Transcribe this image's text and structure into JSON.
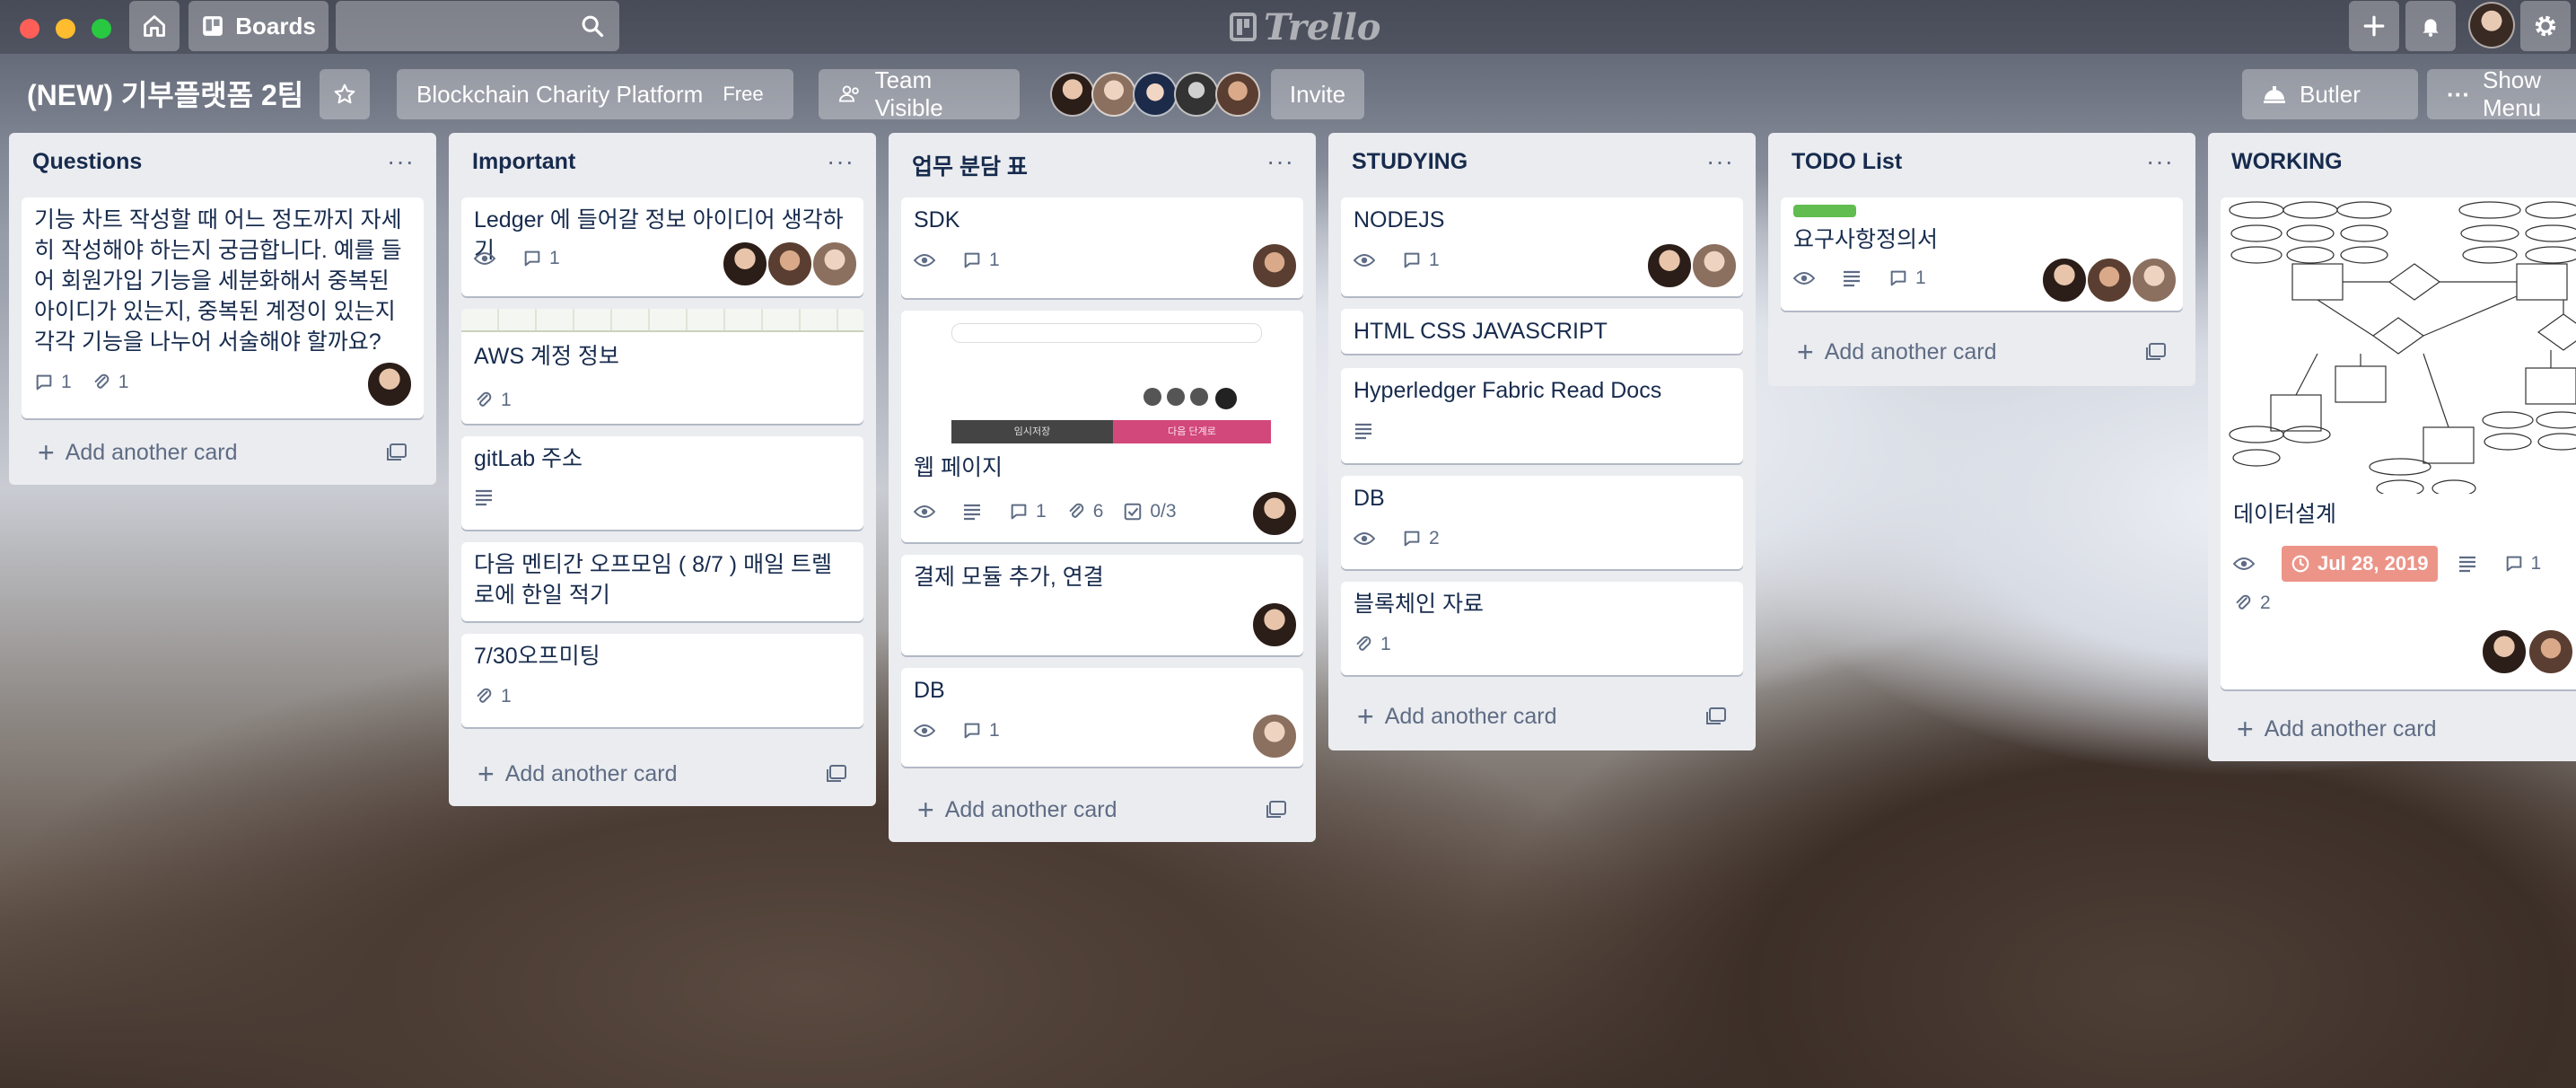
{
  "topbar": {
    "boards_label": "Boards",
    "search_placeholder": "",
    "logo_text": "Trello"
  },
  "board": {
    "title": "(NEW) 기부플랫폼 2팀",
    "team_name": "Blockchain Charity Platform",
    "team_badge": "Free",
    "visibility": "Team Visible",
    "invite_label": "Invite",
    "butler_label": "Butler",
    "show_menu_label": "Show Menu"
  },
  "add_card_label": "Add another card",
  "lists": [
    {
      "title": "Questions",
      "cards": [
        {
          "title": "기능 차트 작성할 때 어느 정도까지 자세히 작성해야 하는지 궁금합니다. 예를 들어 회원가입 기능을 세분화해서 중복된 아이디가 있는지, 중복된 계정이 있는지 각각 기능을 나누어 서술해야 할까요?",
          "comments": "1",
          "attachments": "1"
        }
      ]
    },
    {
      "title": "Important",
      "cards": [
        {
          "title": "Ledger 에 들어갈 정보 아이디어 생각하기",
          "comments": "1"
        },
        {
          "title": "AWS 계정 정보",
          "attachments": "1"
        },
        {
          "title": "gitLab 주소"
        },
        {
          "title": "다음 멘티간 오프모임 ( 8/7 ) 매일 트렐로에 한일 적기"
        },
        {
          "title": "7/30오프미팅",
          "attachments": "1"
        }
      ]
    },
    {
      "title": "업무 분담 표",
      "cards": [
        {
          "title": "SDK",
          "comments": "1"
        },
        {
          "title": "웹 페이지",
          "comments": "1",
          "attachments": "6",
          "checklist": "0/3",
          "cover_tab_left": "임시저장",
          "cover_tab_right": "다음 단계로"
        },
        {
          "title": "결제 모듈 추가, 연결"
        },
        {
          "title": "DB",
          "comments": "1"
        }
      ]
    },
    {
      "title": "STUDYING",
      "cards": [
        {
          "title": "NODEJS",
          "comments": "1"
        },
        {
          "title": "HTML CSS JAVASCRIPT"
        },
        {
          "title": "Hyperledger Fabric Read Docs"
        },
        {
          "title": "DB",
          "comments": "2"
        },
        {
          "title": "블록체인 자료",
          "attachments": "1"
        }
      ]
    },
    {
      "title": "TODO List",
      "cards": [
        {
          "title": "요구사항정의서",
          "comments": "1",
          "label_color": "#61bd4f"
        }
      ]
    },
    {
      "title": "WORKING",
      "cards": [
        {
          "title": "데이터설계",
          "due": "Jul 28, 2019",
          "comments": "1",
          "attachments": "2"
        }
      ]
    }
  ],
  "colors": {
    "list_bg": "#ebecf0",
    "label_green": "#61bd4f",
    "due_badge": "#ec9488",
    "text": "#172b4d",
    "muted": "#5e6c84"
  },
  "icons": [
    "home-icon",
    "boards-icon",
    "search-icon",
    "plus-icon",
    "bell-icon",
    "gear-icon",
    "star-icon",
    "team-icon",
    "butler-icon",
    "more-icon",
    "eye-icon",
    "comment-icon",
    "attachment-icon",
    "description-icon",
    "checklist-icon",
    "clock-icon",
    "template-icon"
  ]
}
